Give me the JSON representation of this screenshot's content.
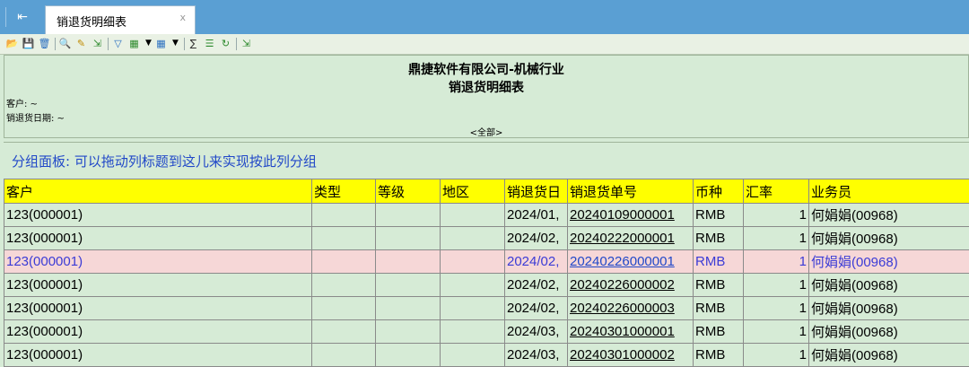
{
  "tab": {
    "label": "销退货明细表",
    "close": "x"
  },
  "toolbar": {
    "icons": [
      "open-folder-icon",
      "save-icon",
      "delete-icon",
      "search-icon",
      "edit-icon",
      "export-icon",
      "filter-icon",
      "layout-icon",
      "grid-icon",
      "filter-sum-icon",
      "tree-icon",
      "refresh-icon",
      "exit-icon"
    ]
  },
  "report": {
    "company": "鼎捷软件有限公司-机械行业",
    "title": "销退货明细表",
    "customer_label": "客户: ~",
    "date_label": "销退货日期: ~",
    "all_label": "<全部>"
  },
  "group_panel": {
    "text": "分组面板: 可以拖动列标题到这儿来实现按此列分组"
  },
  "table": {
    "headers": [
      "客户",
      "类型",
      "等级",
      "地区",
      "销退货日",
      "销退货单号",
      "币种",
      "汇率",
      "业务员"
    ],
    "rows": [
      {
        "customer": "123(000001)",
        "type": "",
        "level": "",
        "region": "",
        "date": "2024/01,",
        "doc": "20240109000001",
        "currency": "RMB",
        "rate": "1",
        "sales": "何娟娟(00968)"
      },
      {
        "customer": "123(000001)",
        "type": "",
        "level": "",
        "region": "",
        "date": "2024/02,",
        "doc": "20240222000001",
        "currency": "RMB",
        "rate": "1",
        "sales": "何娟娟(00968)"
      },
      {
        "customer": "123(000001)",
        "type": "",
        "level": "",
        "region": "",
        "date": "2024/02,",
        "doc": "20240226000001",
        "currency": "RMB",
        "rate": "1",
        "sales": "何娟娟(00968)"
      },
      {
        "customer": "123(000001)",
        "type": "",
        "level": "",
        "region": "",
        "date": "2024/02,",
        "doc": "20240226000002",
        "currency": "RMB",
        "rate": "1",
        "sales": "何娟娟(00968)"
      },
      {
        "customer": "123(000001)",
        "type": "",
        "level": "",
        "region": "",
        "date": "2024/02,",
        "doc": "20240226000003",
        "currency": "RMB",
        "rate": "1",
        "sales": "何娟娟(00968)"
      },
      {
        "customer": "123(000001)",
        "type": "",
        "level": "",
        "region": "",
        "date": "2024/03,",
        "doc": "20240301000001",
        "currency": "RMB",
        "rate": "1",
        "sales": "何娟娟(00968)"
      },
      {
        "customer": "123(000001)",
        "type": "",
        "level": "",
        "region": "",
        "date": "2024/03,",
        "doc": "20240301000002",
        "currency": "RMB",
        "rate": "1",
        "sales": "何娟娟(00968)"
      }
    ]
  }
}
